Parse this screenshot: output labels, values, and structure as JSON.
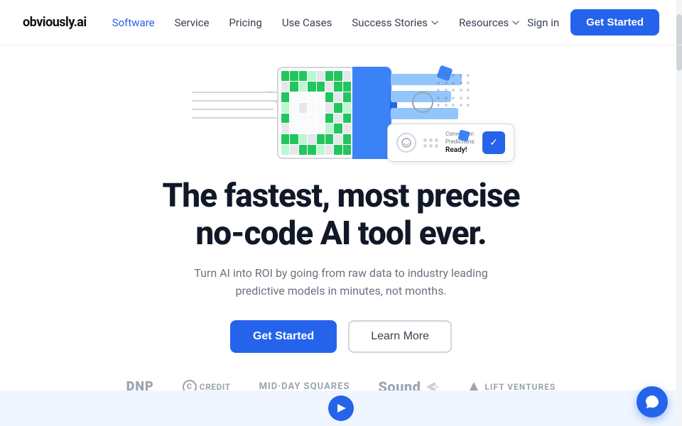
{
  "logo": {
    "text_before": "obvi",
    "text_accent": "ously",
    "text_after": ".ai"
  },
  "nav": {
    "links": [
      {
        "id": "software",
        "label": "Software",
        "active": true,
        "hasDropdown": false
      },
      {
        "id": "service",
        "label": "Service",
        "active": false,
        "hasDropdown": false
      },
      {
        "id": "pricing",
        "label": "Pricing",
        "active": false,
        "hasDropdown": false
      },
      {
        "id": "use-cases",
        "label": "Use Cases",
        "active": false,
        "hasDropdown": false
      },
      {
        "id": "success-stories",
        "label": "Success Stories",
        "active": false,
        "hasDropdown": true
      },
      {
        "id": "resources",
        "label": "Resources",
        "active": false,
        "hasDropdown": true
      }
    ],
    "sign_in": "Sign in",
    "get_started": "Get Started"
  },
  "hero": {
    "heading_line1": "The fastest, most precise",
    "heading_line2": "no-code AI tool ever.",
    "subtext": "Turn AI into ROI by going from raw data to industry leading predictive models in minutes, not months.",
    "btn_primary": "Get Started",
    "btn_secondary": "Learn More"
  },
  "prediction_card": {
    "label": "Conversion Predictions:",
    "value": "Ready!"
  },
  "logos": [
    {
      "id": "dnp",
      "label": "DNP",
      "type": "dnp"
    },
    {
      "id": "credit",
      "label": "CREDIT",
      "type": "credit"
    },
    {
      "id": "midday",
      "label": "MID·DAY SQUARES",
      "type": "midday"
    },
    {
      "id": "sound",
      "label": "Sound",
      "type": "sound"
    },
    {
      "id": "lift",
      "label": "LIFT VENTURES",
      "type": "lift"
    }
  ],
  "chat": {
    "icon": "💬"
  }
}
